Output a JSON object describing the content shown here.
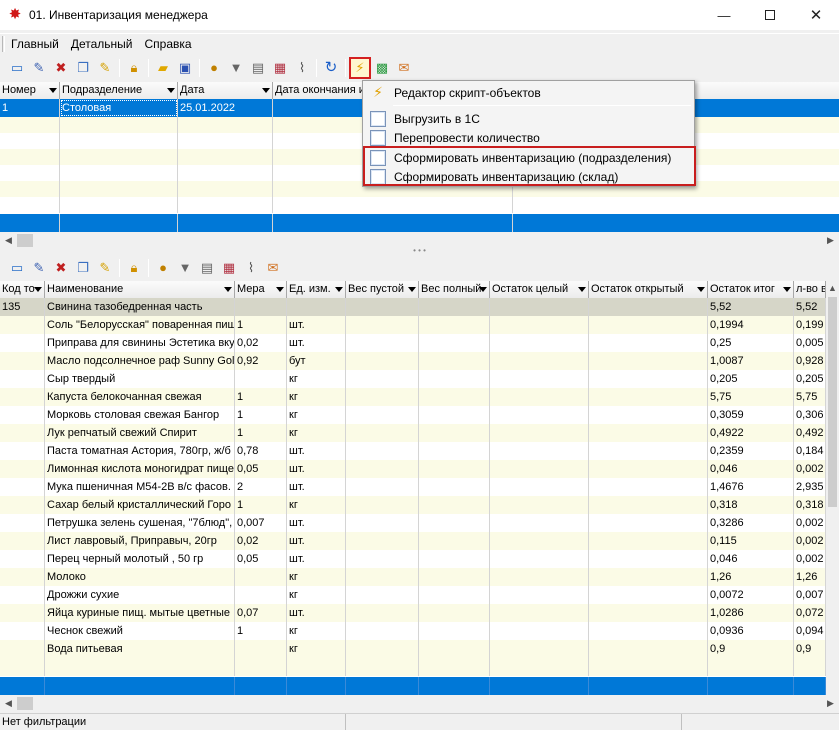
{
  "window": {
    "title": "01. Инвентаризация менеджера",
    "app_icon": "red-star-icon",
    "controls": [
      "minimize-icon",
      "maximize-icon",
      "close-icon"
    ]
  },
  "menu": [
    "Главный",
    "Детальный",
    "Справка"
  ],
  "top_grid": {
    "columns": [
      "Номер",
      "Подразделение",
      "Дата",
      "Дата окончания и"
    ],
    "rows": [
      {
        "num": "1",
        "dept": "Столовая",
        "date": "25.01.2022",
        "end": ""
      }
    ]
  },
  "popup_menu": {
    "items": [
      {
        "label": "Редактор скрипт-объектов",
        "icon": "lightning-icon"
      },
      {
        "label": "Выгрузить в 1С",
        "icon": "sheet-icon"
      },
      {
        "label": "Перепровести количество",
        "icon": "sheet-icon"
      },
      {
        "label": "Сформировать инвентаризацию (подразделения)",
        "icon": "sheet-icon"
      },
      {
        "label": "Сформировать инвентаризацию (склад)",
        "icon": "sheet-icon"
      }
    ]
  },
  "bottom_grid": {
    "columns": [
      "Код то",
      "Наименование",
      "Мера",
      "Ед. изм.",
      "Вес пустой",
      "Вес полный",
      "Остаток целый",
      "Остаток открытый",
      "Остаток итог",
      "л-во в"
    ],
    "rows": [
      {
        "code": "135",
        "name": "Свинина тазобедренная часть",
        "measure": "",
        "unit": "",
        "total": "5,52",
        "qty": "5,52"
      },
      {
        "code": "",
        "name": "Соль \"Белорусская\" поваренная пищ",
        "measure": "1",
        "unit": "шт.",
        "total": "0,1994",
        "qty": "0,199"
      },
      {
        "code": "",
        "name": "Приправа для свинины Эстетика вку",
        "measure": "0,02",
        "unit": "шт.",
        "total": "0,25",
        "qty": "0,005"
      },
      {
        "code": "",
        "name": "Масло подсолнечное раф Sunny Gold",
        "measure": "0,92",
        "unit": "бут",
        "total": "1,0087",
        "qty": "0,928"
      },
      {
        "code": "",
        "name": "Сыр твердый",
        "measure": "",
        "unit": "кг",
        "total": "0,205",
        "qty": "0,205"
      },
      {
        "code": "",
        "name": "Капуста белокочанная свежая",
        "measure": "1",
        "unit": "кг",
        "total": "5,75",
        "qty": "5,75"
      },
      {
        "code": "",
        "name": "Морковь столовая свежая Бангор",
        "measure": "1",
        "unit": "кг",
        "total": "0,3059",
        "qty": "0,306"
      },
      {
        "code": "",
        "name": "Лук репчатый свежий Спирит",
        "measure": "1",
        "unit": "кг",
        "total": "0,4922",
        "qty": "0,492"
      },
      {
        "code": "",
        "name": "Паста томатная Астория, 780гр, ж/б",
        "measure": "0,78",
        "unit": "шт.",
        "total": "0,2359",
        "qty": "0,184"
      },
      {
        "code": "",
        "name": "Лимонная кислота моногидрат пище",
        "measure": "0,05",
        "unit": "шт.",
        "total": "0,046",
        "qty": "0,002"
      },
      {
        "code": "",
        "name": "Мука пшеничная М54-2В в/с фасов. 2",
        "measure": "2",
        "unit": "шт.",
        "total": "1,4676",
        "qty": "2,935"
      },
      {
        "code": "",
        "name": "Сахар белый кристаллический Горо",
        "measure": "1",
        "unit": "кг",
        "total": "0,318",
        "qty": "0,318"
      },
      {
        "code": "",
        "name": "Петрушка зелень сушеная, \"7блюд\",",
        "measure": "0,007",
        "unit": "шт.",
        "total": "0,3286",
        "qty": "0,002"
      },
      {
        "code": "",
        "name": "Лист лавровый, Приправыч, 20гр",
        "measure": "0,02",
        "unit": "шт.",
        "total": "0,115",
        "qty": "0,002"
      },
      {
        "code": "",
        "name": "Перец черный молотый , 50 гр",
        "measure": "0,05",
        "unit": "шт.",
        "total": "0,046",
        "qty": "0,002"
      },
      {
        "code": "",
        "name": "Молоко",
        "measure": "",
        "unit": "кг",
        "total": "1,26",
        "qty": "1,26"
      },
      {
        "code": "",
        "name": "Дрожжи сухие",
        "measure": "",
        "unit": "кг",
        "total": "0,0072",
        "qty": "0,007"
      },
      {
        "code": "",
        "name": "Яйца куриные пищ. мытые цветные",
        "measure": "0,07",
        "unit": "шт.",
        "total": "1,0286",
        "qty": "0,072"
      },
      {
        "code": "",
        "name": "Чеснок свежий",
        "measure": "1",
        "unit": "кг",
        "total": "0,0936",
        "qty": "0,094"
      },
      {
        "code": "",
        "name": "Вода питьевая",
        "measure": "",
        "unit": "кг",
        "total": "0,9",
        "qty": "0,9"
      }
    ]
  },
  "status": {
    "filter": "Нет фильтрации"
  }
}
